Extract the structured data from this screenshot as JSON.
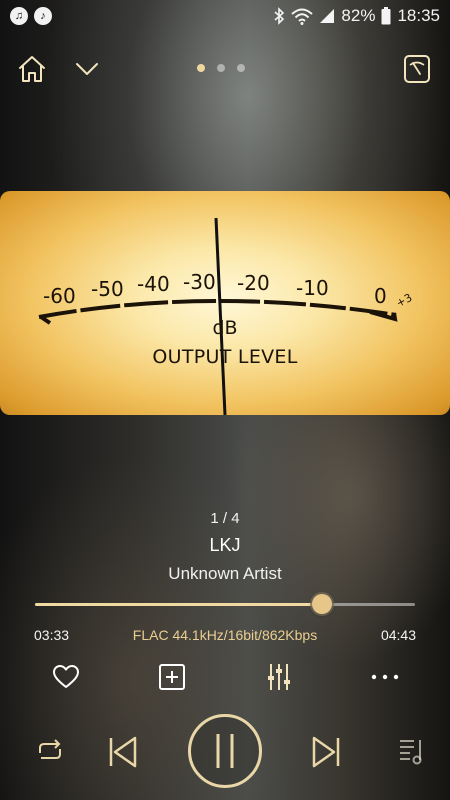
{
  "status_bar": {
    "left_apps": [
      "music-app-icon",
      "audio-app-icon"
    ],
    "battery": "82%",
    "time": "18:35",
    "icons": [
      "bluetooth-icon",
      "wifi-icon",
      "signal-icon",
      "battery-icon"
    ]
  },
  "top_bar": {
    "page_count": 3,
    "active_page": 1
  },
  "vu_meter": {
    "scale": [
      "-60",
      "-50",
      "-40",
      "-30",
      "-20",
      "-10",
      "0",
      "+3"
    ],
    "unit": "dB",
    "title": "OUTPUT LEVEL",
    "colors": {
      "face": "#f2c462",
      "needle": "#111111"
    }
  },
  "track": {
    "index": "1 / 4",
    "title": "LKJ",
    "artist": "Unknown Artist"
  },
  "playback": {
    "elapsed": "03:33",
    "total": "04:43",
    "progress_fraction": 0.754,
    "format": "FLAC 44.1kHz/16bit/862Kbps"
  },
  "colors": {
    "accent": "#e9cf91",
    "progress_fill": "#f1d9a2"
  }
}
